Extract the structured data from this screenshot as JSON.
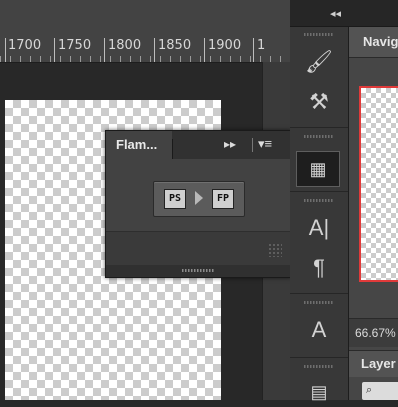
{
  "ruler": {
    "labels": [
      "1700",
      "1750",
      "1800",
      "1850",
      "1900",
      "1"
    ]
  },
  "flame_panel": {
    "tab_title": "Flam...",
    "collapse_glyph": "▸▸",
    "menu_glyph": "▾≡",
    "button_left_label": "PS",
    "button_right_label": "FP"
  },
  "right_dock": {
    "collapse_glyph": "◂◂",
    "tools": [
      {
        "name": "brush-presets-icon",
        "glyph": "🖌"
      },
      {
        "name": "tool-presets-icon",
        "glyph": "⚒"
      },
      {
        "name": "plugin-panel-icon",
        "glyph": "▦"
      },
      {
        "name": "character-icon",
        "glyph": "A|"
      },
      {
        "name": "paragraph-icon",
        "glyph": "¶"
      },
      {
        "name": "character-styles-icon",
        "glyph": "A"
      },
      {
        "name": "paragraph-styles-icon",
        "glyph": "▤"
      }
    ]
  },
  "navigator": {
    "title": "Navig",
    "zoom": "66.67%"
  },
  "layers": {
    "title": "Layer",
    "filter_glyph": "⌕"
  },
  "colors": {
    "accent_border": "#e03a3a"
  }
}
